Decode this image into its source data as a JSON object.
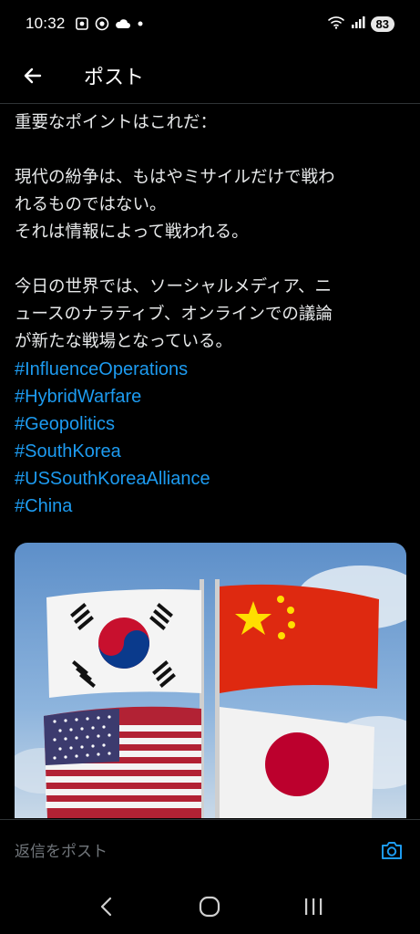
{
  "status_bar": {
    "time": "10:32",
    "battery": "83"
  },
  "header": {
    "title": "ポスト"
  },
  "post": {
    "lines_1": [
      "重要なポイントはこれだ："
    ],
    "lines_2": [
      "現代の紛争は、もはやミサイルだけで戦わ",
      "れるものではない。",
      "それは情報によって戦われる。"
    ],
    "lines_3": [
      "今日の世界では、ソーシャルメディア、ニ",
      "ュースのナラティブ、オンラインでの議論",
      "が新たな戦場となっている。"
    ],
    "hashtags": [
      "#InfluenceOperations",
      "#HybridWarfare",
      "#Geopolitics",
      "#SouthKorea",
      "#USSouthKoreaAlliance",
      "#China"
    ]
  },
  "reply": {
    "placeholder": "返信をポスト"
  },
  "colors": {
    "accent": "#1d9bf0",
    "text": "#e7e9ea",
    "muted": "#71767b",
    "divider": "#2f3336"
  }
}
